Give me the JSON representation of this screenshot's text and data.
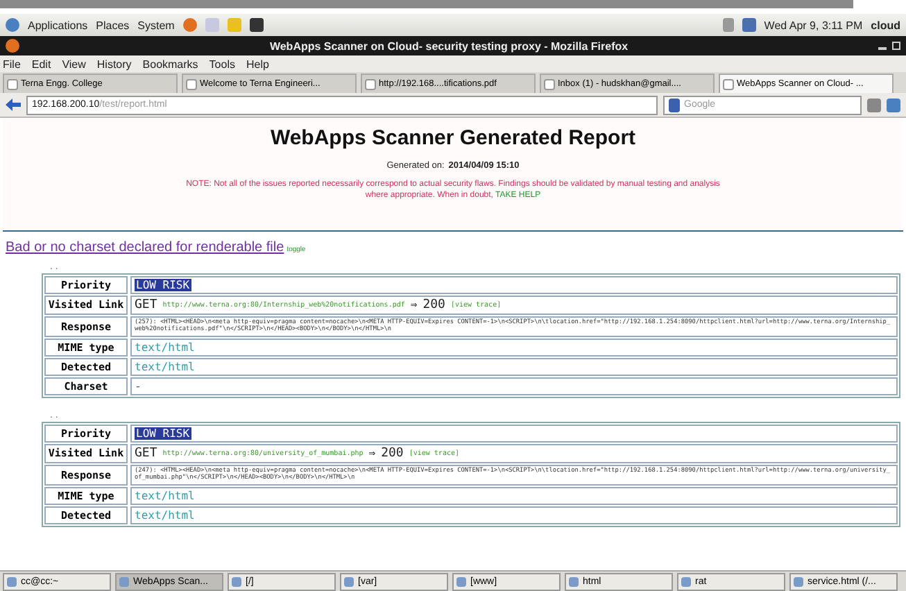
{
  "top_panel": {
    "menus": [
      "Applications",
      "Places",
      "System"
    ],
    "clock": "Wed Apr  9,  3:11 PM",
    "user": "cloud"
  },
  "window": {
    "title": "WebApps Scanner on Cloud- security testing proxy - Mozilla Firefox"
  },
  "menu_bar": [
    "File",
    "Edit",
    "View",
    "History",
    "Bookmarks",
    "Tools",
    "Help"
  ],
  "tabs": [
    {
      "label": "Terna Engg. College",
      "selected": false
    },
    {
      "label": "Welcome to Terna Engineeri...",
      "selected": false
    },
    {
      "label": "http://192.168....tifications.pdf",
      "selected": false
    },
    {
      "label": "Inbox (1) - hudskhan@gmail....",
      "selected": false
    },
    {
      "label": "WebApps Scanner on Cloud- ...",
      "selected": true
    }
  ],
  "address_bar": {
    "host": "192.168.200.10",
    "path": "/test/report.html"
  },
  "search": {
    "placeholder": "Google"
  },
  "report": {
    "title": "WebApps Scanner Generated Report",
    "generated_label": "Generated on:",
    "generated_value": "2014/04/09 15:10",
    "note": "NOTE: Not all of the issues reported necessarily correspond to actual security flaws. Findings should be validated by manual testing and analysis where appropriate. When in doubt,",
    "help_link": "TAKE HELP",
    "issue": "Bad or no charset declared for renderable file",
    "toggle": "toggle",
    "findings": [
      {
        "marker": ". .",
        "labels": {
          "priority": "Priority",
          "visited": "Visited Link",
          "response": "Response",
          "mime": "MIME type",
          "detected": "Detected",
          "charset": "Charset"
        },
        "priority": "LOW RISK",
        "method": "GET",
        "url": "http://www.terna.org:80/Internship_web%20notifications.pdf",
        "arrow": "⇒",
        "status": "200",
        "trace": "[view trace]",
        "response": "(257): <HTML><HEAD>\\n<meta http-equiv=pragma content=nocache>\\n<META HTTP-EQUIV=Expires CONTENT=-1>\\n<SCRIPT>\\n\\tlocation.href=\"http://192.168.1.254:8090/httpclient.html?url=http://www.terna.org/Internship_web%20notifications.pdf\"\\n</SCRIPT>\\n</HEAD><BODY>\\n</BODY>\\n</HTML>\\n",
        "mime": "text/html",
        "detected": "text/html",
        "charset": "-"
      },
      {
        "marker": ". .",
        "labels": {
          "priority": "Priority",
          "visited": "Visited Link",
          "response": "Response",
          "mime": "MIME type",
          "detected": "Detected"
        },
        "priority": "LOW RISK",
        "method": "GET",
        "url": "http://www.terna.org:80/university_of_mumbai.php",
        "arrow": "⇒",
        "status": "200",
        "trace": "[view trace]",
        "response": "(247): <HTML><HEAD>\\n<meta http-equiv=pragma content=nocache>\\n<META HTTP-EQUIV=Expires CONTENT=-1>\\n<SCRIPT>\\n\\tlocation.href=\"http://192.168.1.254:8090/httpclient.html?url=http://www.terna.org/university_of_mumbai.php\"\\n</SCRIPT>\\n</HEAD><BODY>\\n</BODY>\\n</HTML>\\n",
        "mime": "text/html",
        "detected": "text/html"
      }
    ]
  },
  "taskbar": [
    {
      "label": "cc@cc:~",
      "selected": false
    },
    {
      "label": "WebApps Scan...",
      "selected": true
    },
    {
      "label": "[/]",
      "selected": false
    },
    {
      "label": "[var]",
      "selected": false
    },
    {
      "label": "[www]",
      "selected": false
    },
    {
      "label": "html",
      "selected": false
    },
    {
      "label": "rat",
      "selected": false
    },
    {
      "label": "service.html (/...",
      "selected": false
    }
  ]
}
